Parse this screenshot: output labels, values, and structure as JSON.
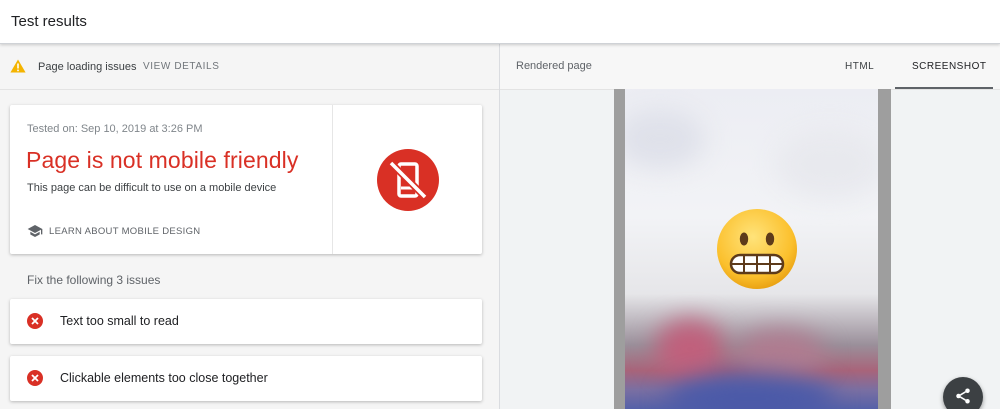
{
  "header": {
    "title": "Test results"
  },
  "left_panel": {
    "issues_bar": {
      "label": "Page loading issues",
      "action": "VIEW DETAILS"
    },
    "result": {
      "tested_on": "Tested on: Sep 10, 2019 at 3:26 PM",
      "headline": "Page is not mobile friendly",
      "subtitle": "This page can be difficult to use on a mobile device",
      "learn_link": "LEARN ABOUT MOBILE DESIGN",
      "badge_icon": "not-mobile-friendly-icon"
    },
    "fix_heading": "Fix the following 3 issues",
    "issues": [
      {
        "label": "Text too small to read",
        "icon": "error-icon"
      },
      {
        "label": "Clickable elements too close together",
        "icon": "error-icon"
      }
    ]
  },
  "right_panel": {
    "label": "Rendered page",
    "tabs": [
      {
        "label": "HTML",
        "active": false
      },
      {
        "label": "SCREENSHOT",
        "active": true
      }
    ],
    "preview_overlay_icon": "grimacing-face-emoji",
    "fab_icon": "share-icon"
  },
  "colors": {
    "error_red": "#d93025",
    "warning_yellow": "#f4b400",
    "fab_dark": "#3c4043"
  }
}
